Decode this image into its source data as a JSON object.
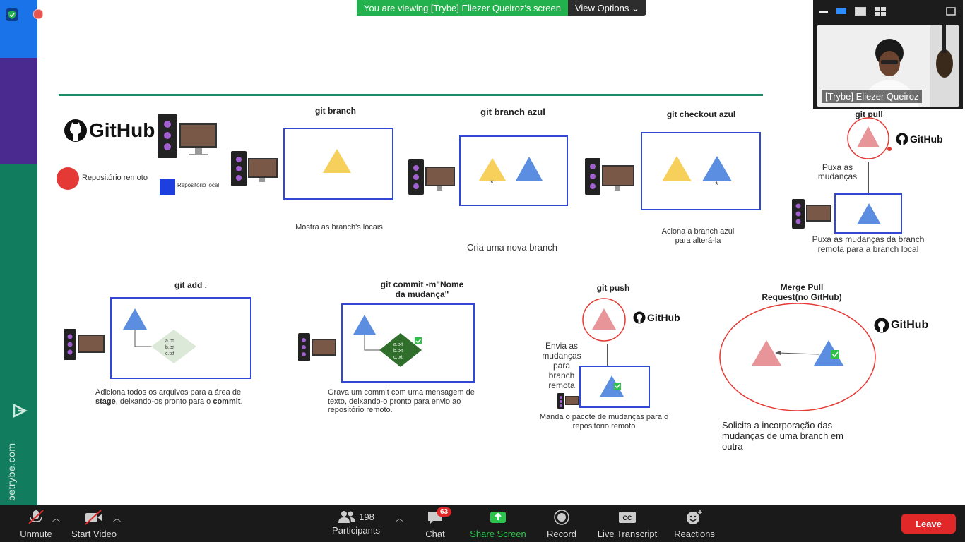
{
  "banner": {
    "message": "You are viewing [Trybe] Eliezer Queiroz's screen",
    "view_options": "View Options"
  },
  "video": {
    "participant_name": "[Trybe] Eliezer Queiroz"
  },
  "sidebar": {
    "site": "betrybe.com"
  },
  "slide": {
    "github_label": "GitHub",
    "legend_remote": "Repositório remoto",
    "legend_local": "Repositório local",
    "git_branch": {
      "title": "git branch",
      "caption": "Mostra as branch's locais"
    },
    "git_branch_azul": {
      "title": "git branch azul",
      "caption": "Cria uma nova branch",
      "star": "*"
    },
    "git_checkout": {
      "title": "git checkout azul",
      "caption_1": "Aciona a branch azul",
      "caption_2": "para alterá-la",
      "star": "*"
    },
    "git_pull": {
      "title": "git pull",
      "side_1": "Puxa as",
      "side_2": "mudanças",
      "caption_1": "Puxa as mudanças da branch",
      "caption_2": "remota para a branch local"
    },
    "git_add": {
      "title": "git add .",
      "files": [
        "a.txt",
        "b.txt",
        "c.txt"
      ],
      "caption_1": "Adiciona todos os arquivos para a área de",
      "caption_2a": "stage",
      "caption_2b": ", deixando-os pronto para o ",
      "caption_2c": "commit",
      "caption_2d": "."
    },
    "git_commit": {
      "title_1": "git commit -m\"Nome",
      "title_2": "da mudança\"",
      "files": [
        "a.txt",
        "b.txt",
        "c.txt"
      ],
      "caption_1": "Grava um commit com uma mensagem de",
      "caption_2": "texto, deixando-o pronto para envio ao",
      "caption_3": "repositório remoto."
    },
    "git_push": {
      "title": "git push",
      "side": [
        "Envia as",
        "mudanças",
        "para",
        "branch",
        "remota"
      ],
      "caption_1": "Manda o pacote de mudanças para o",
      "caption_2": "repositório remoto"
    },
    "merge": {
      "title_1": "Merge Pull",
      "title_2": "Request(no GitHub)",
      "caption_1": "Solicita a incorporação das",
      "caption_2": "mudanças de uma branch em",
      "caption_3": "outra"
    }
  },
  "toolbar": {
    "unmute": "Unmute",
    "start_video": "Start Video",
    "participants": "Participants",
    "participants_count": "198",
    "chat": "Chat",
    "chat_badge": "63",
    "share_screen": "Share Screen",
    "record": "Record",
    "live_transcript": "Live Transcript",
    "reactions": "Reactions",
    "leave": "Leave"
  },
  "colors": {
    "blue_box": "#3247d6",
    "yellow": "#f7cf5b",
    "blue_tri": "#5b8ee0",
    "pink": "#e8959a",
    "red": "#e53935",
    "green_banner": "#23b14d",
    "leave": "#e02828"
  }
}
